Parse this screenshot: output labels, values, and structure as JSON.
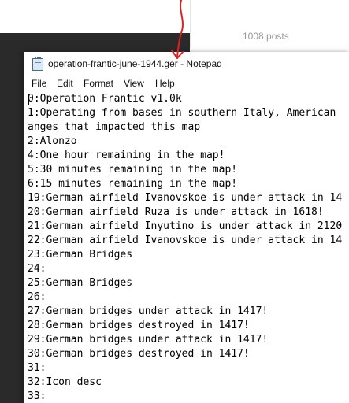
{
  "forum": {
    "posts_count": "1008 posts"
  },
  "window": {
    "title": "operation-frantic-june-1944.ger - Notepad"
  },
  "menu": {
    "items": [
      "File",
      "Edit",
      "Format",
      "View",
      "Help"
    ]
  },
  "editor": {
    "lines": [
      "0:Operation Frantic v1.0k",
      "1:Operating from bases in southern Italy, American",
      "anges that impacted this map",
      "2:Alonzo",
      "4:One hour remaining in the map!",
      "5:30 minutes remaining in the map!",
      "6:15 minutes remaining in the map!",
      "19:German airfield Ivanovskoe is under attack in 14",
      "20:German airfield Ruza is under attack in 1618!",
      "21:German airfield Inyutino is under attack in 2120",
      "22:German airfield Ivanovskoe is under attack in 14",
      "23:German Bridges",
      "24:",
      "25:German Bridges",
      "26:",
      "27:German bridges under attack in 1417!",
      "28:German bridges destroyed in 1417!",
      "29:German bridges under attack in 1417!",
      "30:German bridges destroyed in 1417!",
      "31:",
      "32:Icon desc",
      "33:"
    ]
  },
  "colors": {
    "annotation_arrow": "#e02020",
    "background_dark": "#2a2a2a"
  }
}
